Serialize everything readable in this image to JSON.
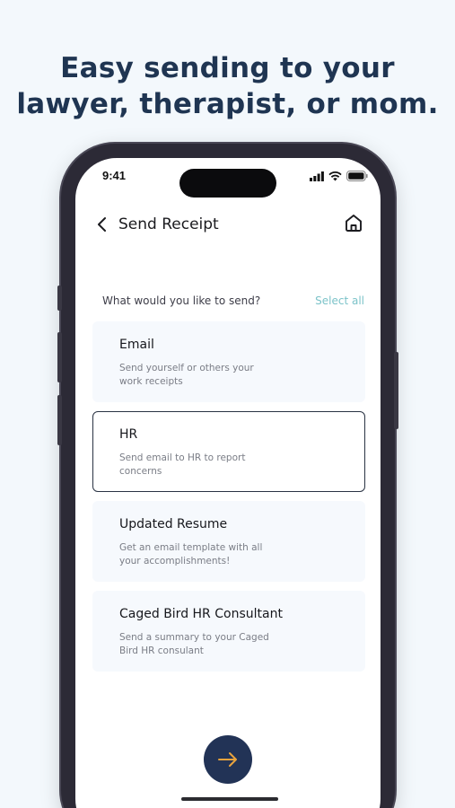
{
  "headline": {
    "line1": "Easy sending to your",
    "line2": "lawyer, therapist, or mom."
  },
  "status_bar": {
    "time": "9:41",
    "icons": [
      "signal-icon",
      "wifi-icon",
      "battery-icon"
    ]
  },
  "nav": {
    "title": "Send Receipt",
    "back_icon": "chevron-left-icon",
    "home_icon": "home-icon"
  },
  "prompt": {
    "question": "What would you like to send?",
    "select_all": "Select all"
  },
  "options": [
    {
      "title": "Email",
      "description": "Send yourself or others your work receipts",
      "selected": false
    },
    {
      "title": "HR",
      "description": "Send email to HR to report concerns",
      "selected": true
    },
    {
      "title": "Updated Resume",
      "description": "Get an email template with all your accomplishments!",
      "selected": false
    },
    {
      "title": "Caged Bird HR Consultant",
      "description": "Send a summary to your Caged Bird HR consulant",
      "selected": false
    }
  ],
  "next_button": {
    "icon": "arrow-right-icon",
    "accent": "#e8a33d"
  },
  "colors": {
    "background": "#f3f8fc",
    "headline": "#1f3552",
    "select_all": "#7cc3c9",
    "button": "#223356",
    "selected_border": "#2a3343",
    "card": "#f6f9fd"
  }
}
